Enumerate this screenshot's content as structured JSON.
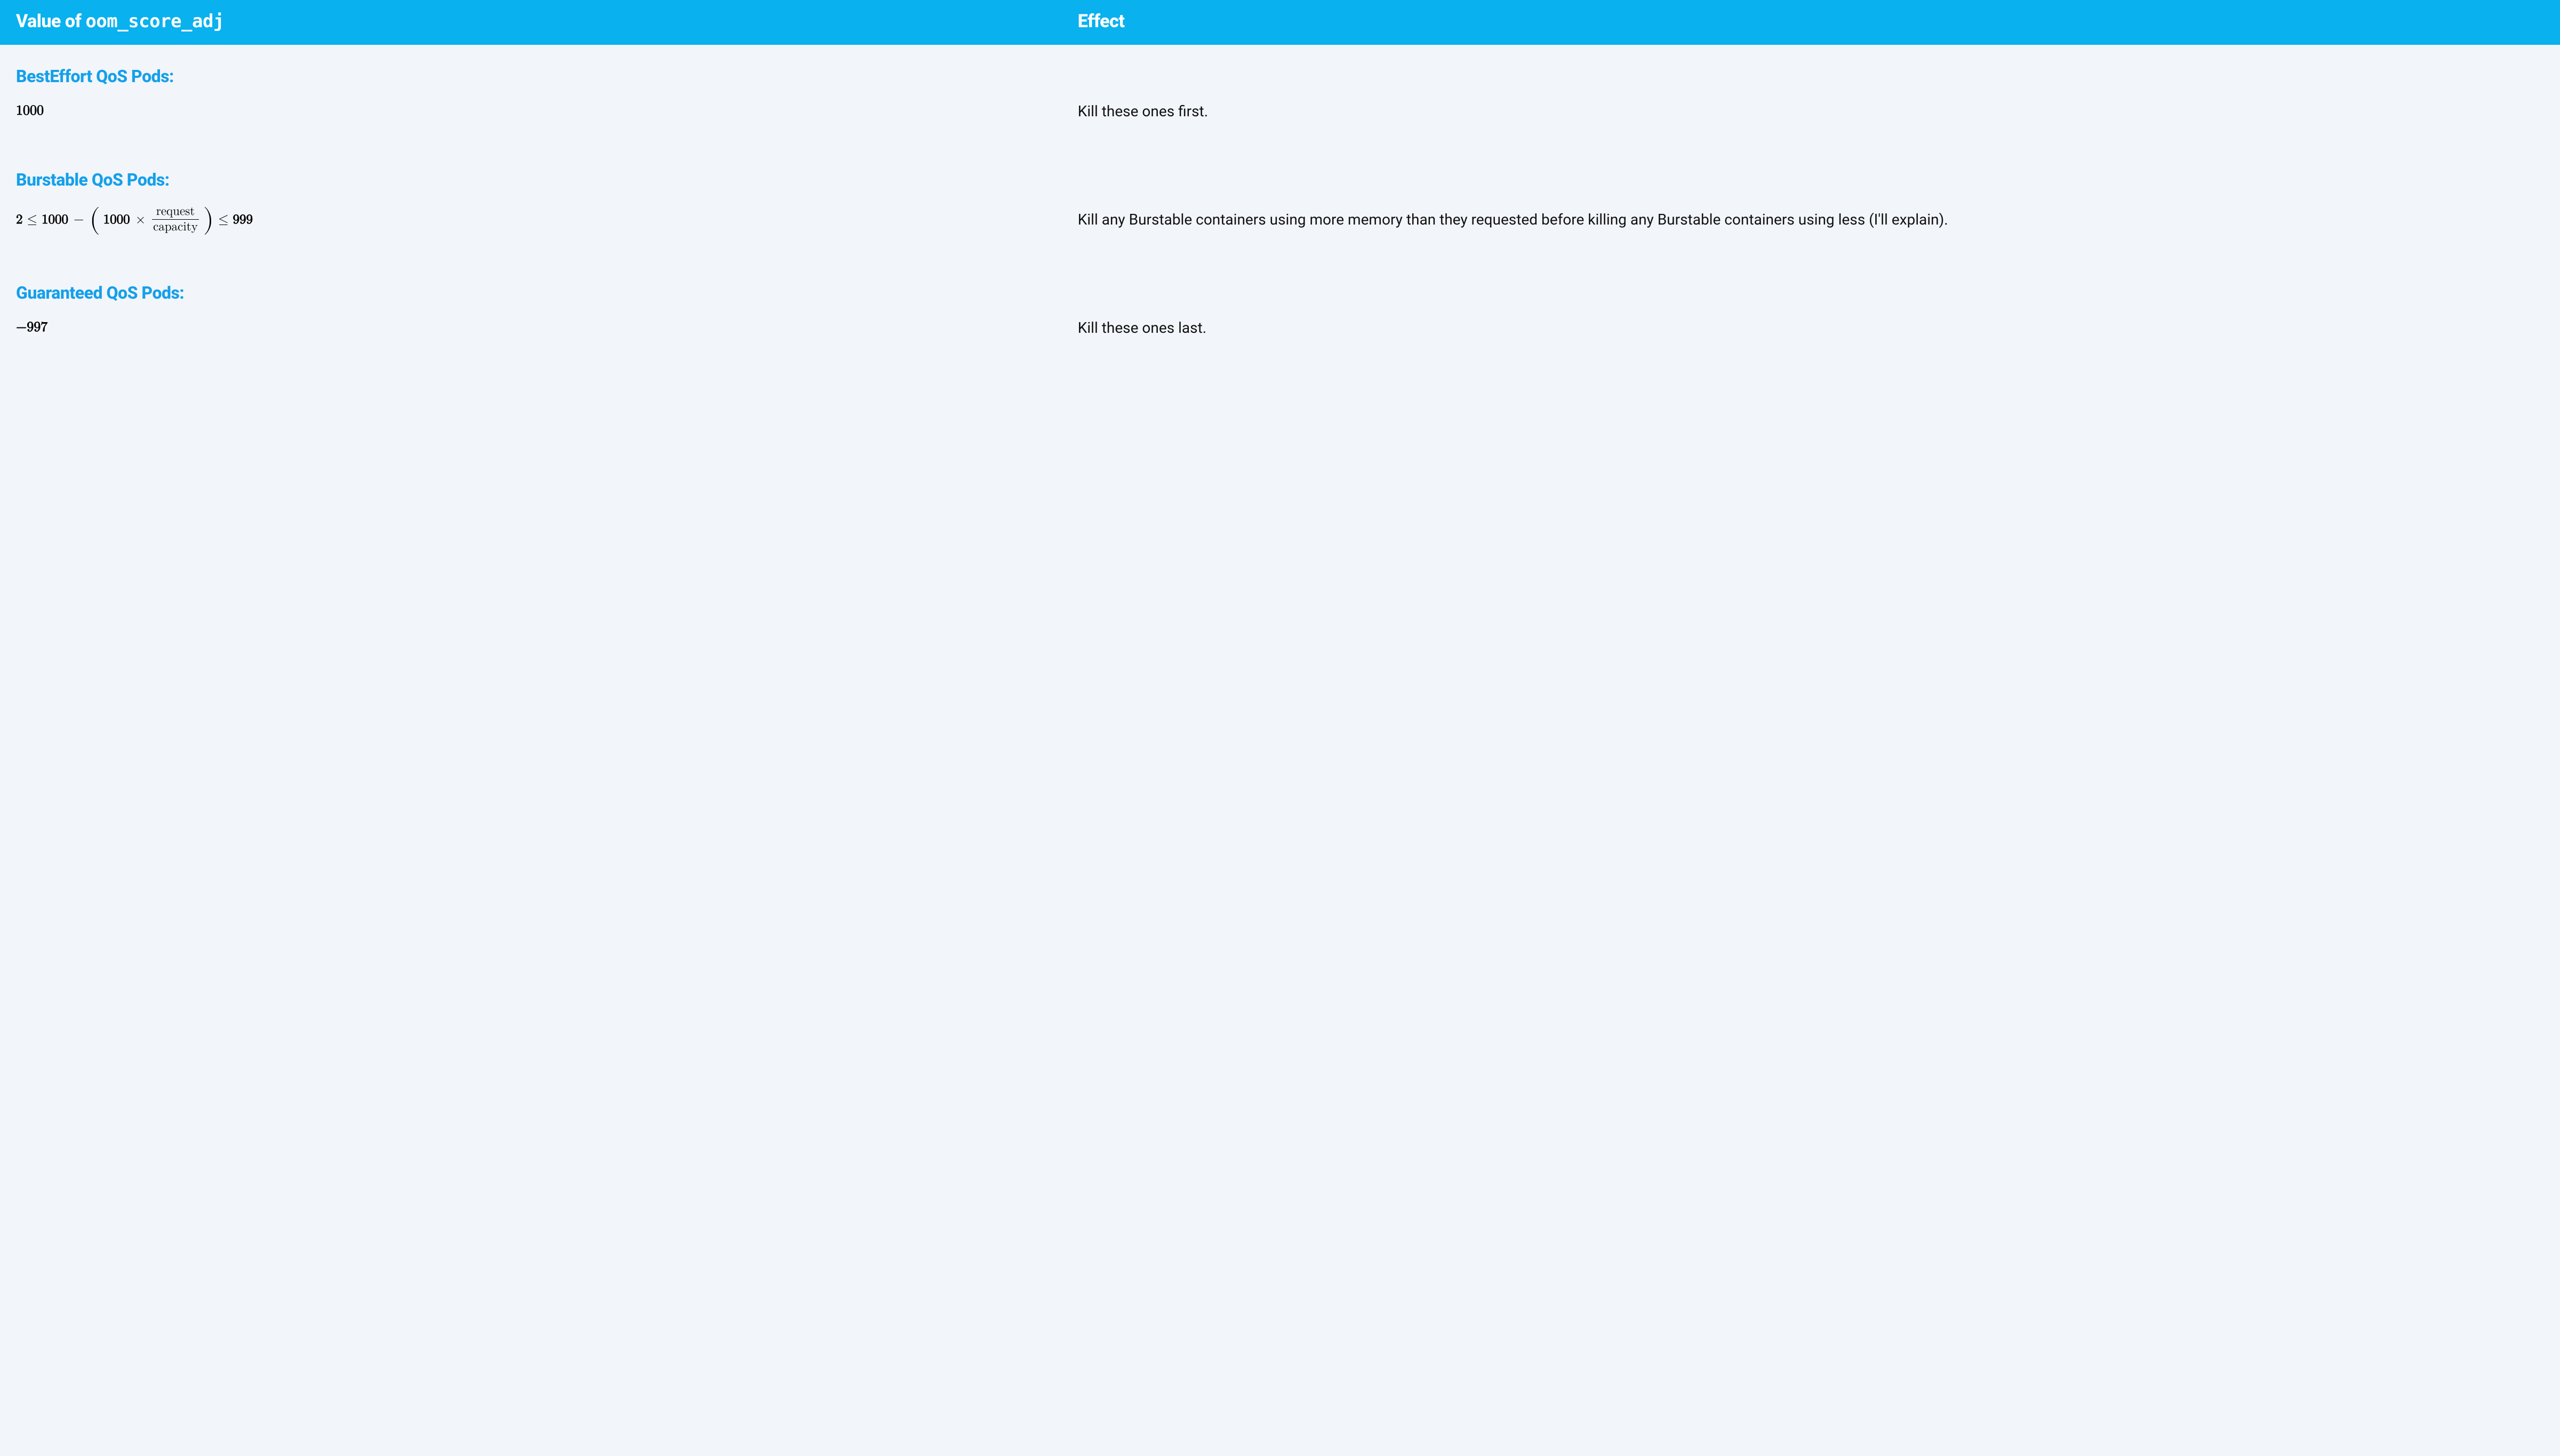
{
  "header": {
    "value_label_prefix": "Value of ",
    "value_label_code": "oom_score_adj",
    "effect_label": "Effect"
  },
  "sections": [
    {
      "title": "BestEffort QoS Pods:",
      "value_plain": "1000",
      "effect": "Kill these ones first."
    },
    {
      "title": "Burstable QoS Pods:",
      "formula": {
        "lower": "2",
        "le1": "≤",
        "a": "1000",
        "minus": "−",
        "b": "1000",
        "times": "×",
        "frac_num": "request",
        "frac_den": "capacity",
        "le2": "≤",
        "upper": "999"
      },
      "effect": "Kill any Burstable containers using more memory than they requested before killing any Burstable containers using less (I'll explain)."
    },
    {
      "title": "Guaranteed QoS Pods:",
      "value_plain": "−997",
      "effect": "Kill these ones last."
    }
  ]
}
